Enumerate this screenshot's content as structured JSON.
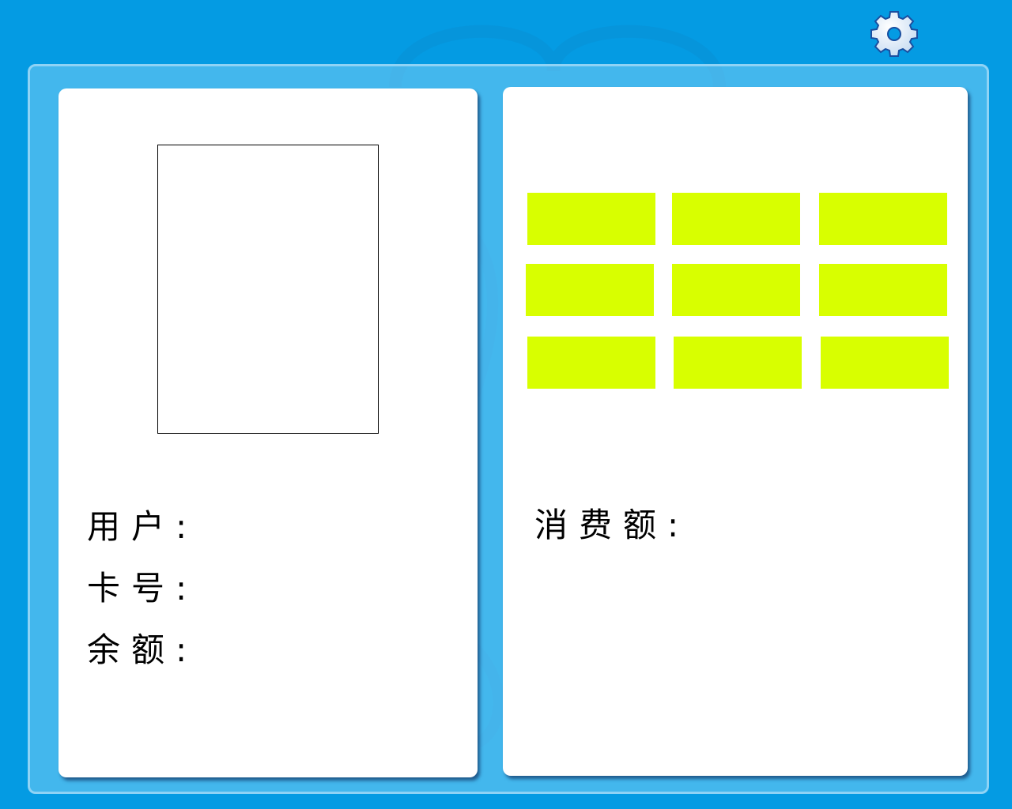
{
  "settings": {
    "icon": "gear-icon",
    "icon_color": "#ffffff",
    "icon_outline": "#1a4fa0"
  },
  "colors": {
    "background": "#049be3",
    "frame": "#78cdf5",
    "panel": "#ffffff",
    "tile": "#d8ff00"
  },
  "user_panel": {
    "user_label": "用户:",
    "card_label": "卡号:",
    "balance_label": "余额:"
  },
  "spend_panel": {
    "spend_label": "消费额:",
    "tiles": [
      "",
      "",
      "",
      "",
      "",
      "",
      "",
      "",
      ""
    ]
  }
}
